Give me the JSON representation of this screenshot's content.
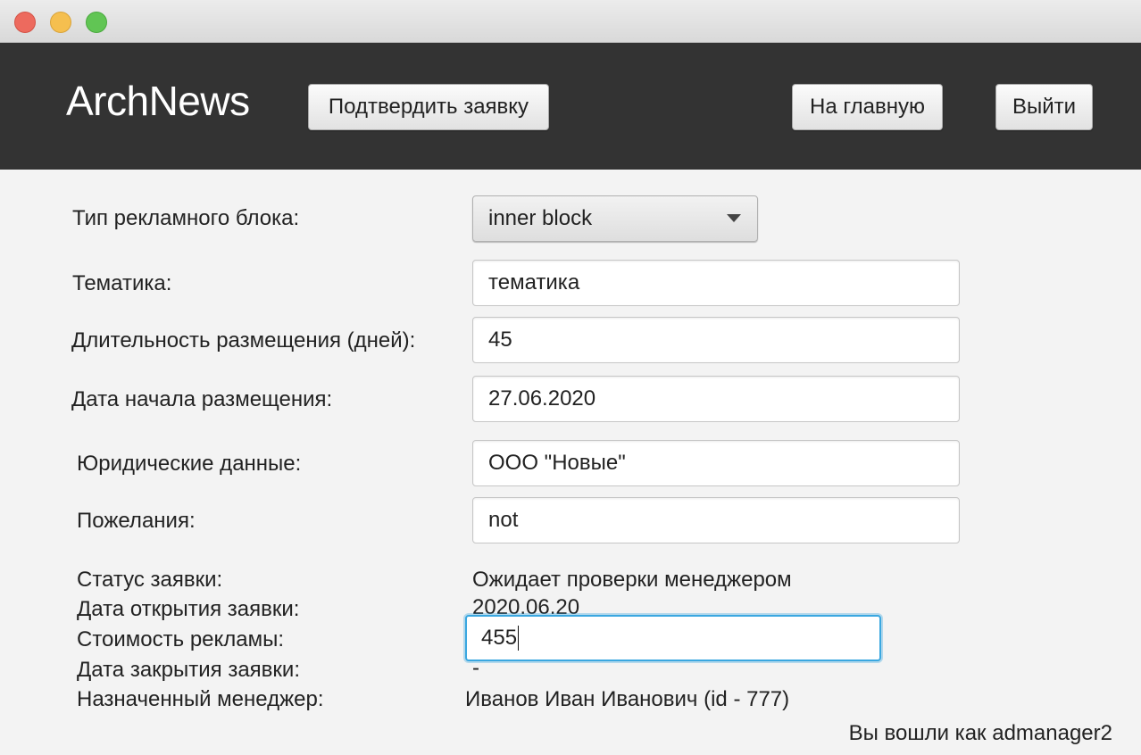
{
  "window": {
    "buttons": [
      "close",
      "minimize",
      "maximize"
    ]
  },
  "header": {
    "logo": "ArchNews",
    "confirm_label": "Подтвердить заявку",
    "home_label": "На главную",
    "logout_label": "Выйти",
    "background": "#333333"
  },
  "form": {
    "block_type": {
      "label": "Тип рекламного блока:",
      "value": "inner block"
    },
    "topic": {
      "label": "Тематика:",
      "value": "тематика"
    },
    "duration": {
      "label": "Длительность размещения (дней):",
      "value": "45"
    },
    "start_date": {
      "label": "Дата начала размещения:",
      "value": "27.06.2020"
    },
    "legal": {
      "label": "Юридические данные:",
      "value": "ООО \"Новые\""
    },
    "wishes": {
      "label": "Пожелания:",
      "value": "not"
    }
  },
  "info": {
    "status": {
      "label": "Статус заявки:",
      "value": "Ожидает проверки менеджером"
    },
    "open_date": {
      "label": "Дата открытия заявки:",
      "value": "2020.06.20"
    },
    "cost": {
      "label": "Стоимость рекламы:",
      "value": "455"
    },
    "close_date": {
      "label": "Дата закрытия заявки:",
      "value": "-"
    },
    "manager": {
      "label": "Назначенный менеджер:",
      "value": "Иванов Иван Иванович (id - 777)"
    }
  },
  "footer": {
    "logged_in": "Вы вошли как admanager2"
  },
  "colors": {
    "focus": "#3aa7e0"
  }
}
